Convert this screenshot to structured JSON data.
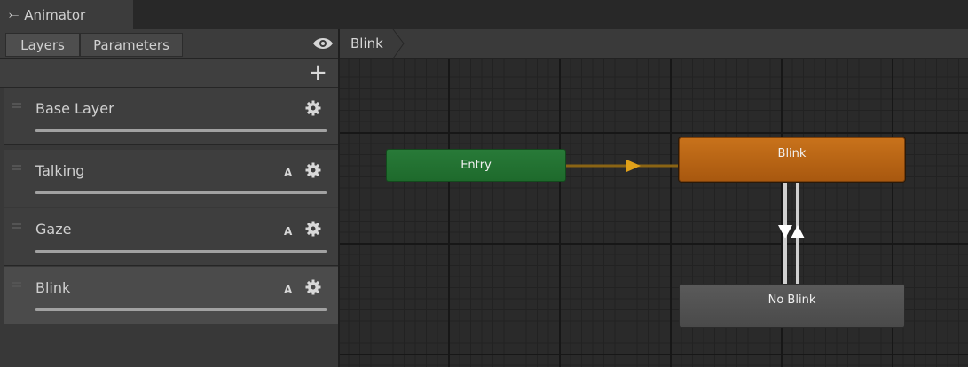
{
  "window": {
    "title": "Animator"
  },
  "panel": {
    "tabs": [
      {
        "label": "Layers"
      },
      {
        "label": "Parameters"
      }
    ],
    "layers": [
      {
        "name": "Base Layer",
        "badge": ""
      },
      {
        "name": "Talking",
        "badge": "A"
      },
      {
        "name": "Gaze",
        "badge": "A"
      },
      {
        "name": "Blink",
        "badge": "A"
      }
    ],
    "selected_layer": "Blink"
  },
  "breadcrumb": {
    "current": "Blink"
  },
  "graph": {
    "states": {
      "entry": {
        "label": "Entry",
        "color": "#237230"
      },
      "blink": {
        "label": "Blink",
        "color": "#b8661a"
      },
      "no_blink": {
        "label": "No Blink",
        "color": "#535353"
      }
    },
    "transition_color": "#8a6414"
  },
  "icons": {
    "window": "animator-icon",
    "visibility": "eye-icon",
    "add": "plus-icon",
    "settings": "gear-icon",
    "drag": "drag-handle-icon"
  }
}
